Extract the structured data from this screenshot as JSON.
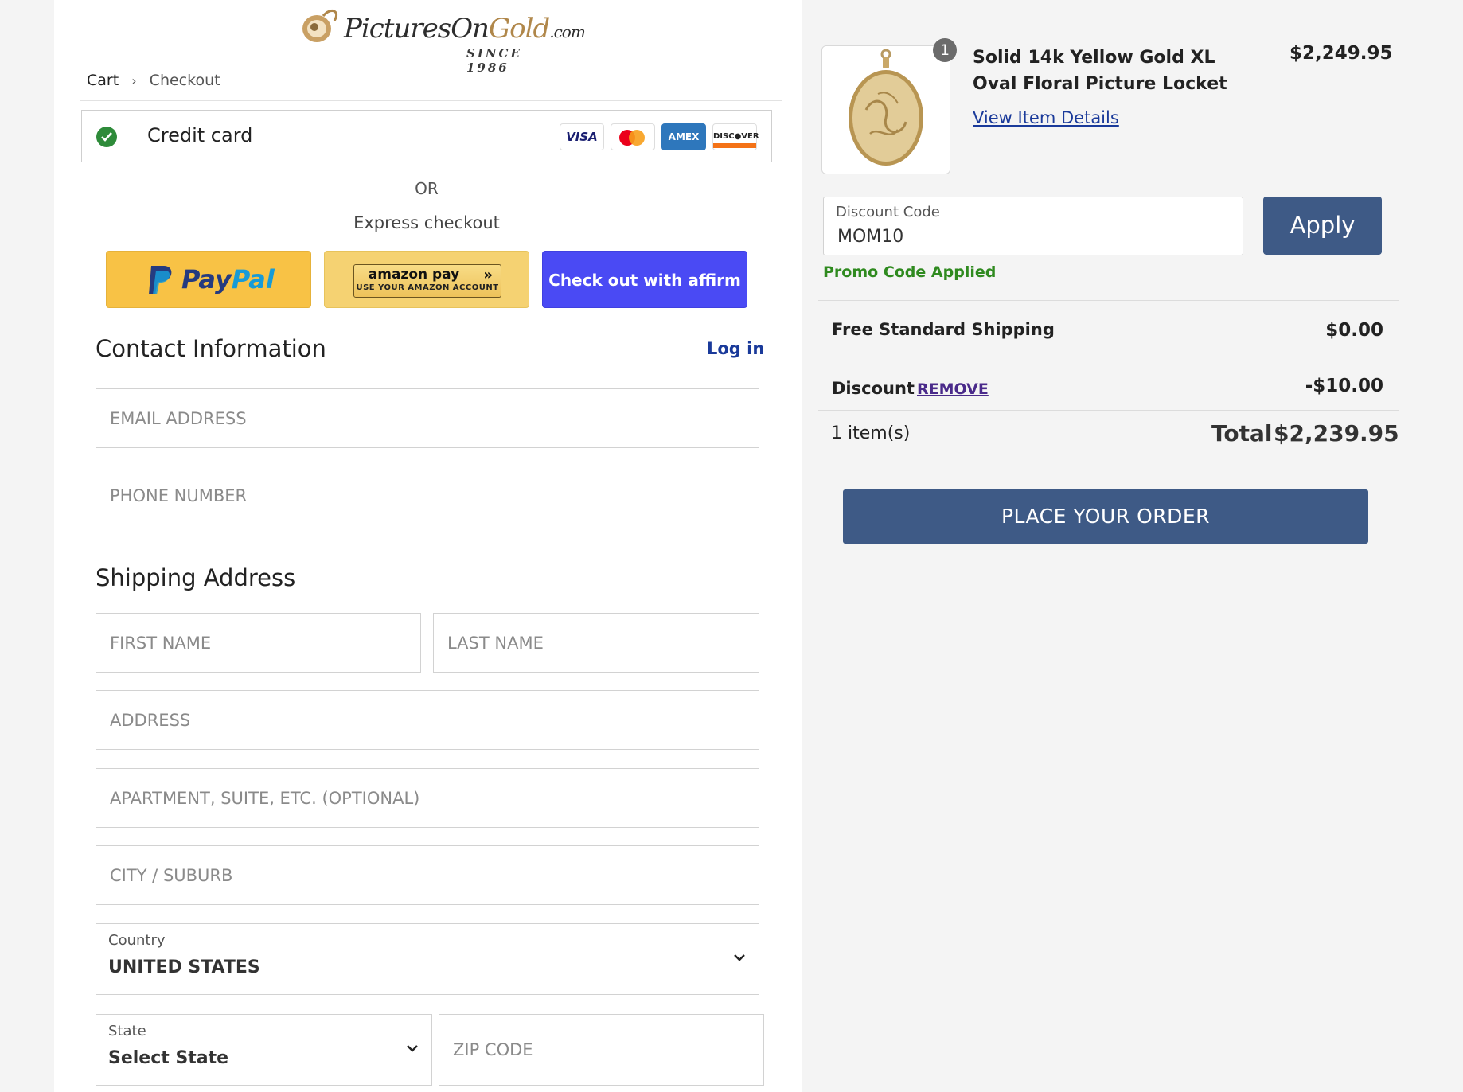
{
  "brand": {
    "logo_prefix": "Pictures",
    "logo_mid": "On",
    "logo_gold": "Gold",
    "logo_suffix": ".com",
    "since": "SINCE 1986"
  },
  "breadcrumb": {
    "cart": "Cart",
    "separator": "›",
    "checkout": "Checkout"
  },
  "payment": {
    "credit_card_label": "Credit card",
    "cards": {
      "visa": "VISA",
      "amex": "AMEX",
      "discover": "DISC●VER"
    },
    "or_label": "OR",
    "express_label": "Express checkout",
    "paypal_pay": "Pay",
    "paypal_pal": "Pal",
    "amazon_top": "amazon pay",
    "amazon_arrows": "»",
    "amazon_bottom": "USE YOUR AMAZON ACCOUNT",
    "affirm_label": "Check out with affirm"
  },
  "contact": {
    "title": "Contact Information",
    "login": "Log in",
    "email_placeholder": "EMAIL ADDRESS",
    "phone_placeholder": "PHONE NUMBER"
  },
  "shipping": {
    "title": "Shipping Address",
    "first_name_placeholder": "FIRST NAME",
    "last_name_placeholder": "LAST NAME",
    "address_placeholder": "ADDRESS",
    "apartment_placeholder": "APARTMENT, SUITE, ETC. (OPTIONAL)",
    "city_placeholder": "CITY / SUBURB",
    "country_label": "Country",
    "country_value": "UNITED STATES",
    "state_label": "State",
    "state_value": "Select State",
    "zip_placeholder": "ZIP CODE"
  },
  "order": {
    "quantity_badge": "1",
    "product_name": "Solid 14k Yellow Gold XL Oval Floral Picture Locket",
    "product_price": "$2,249.95",
    "view_details": "View Item Details",
    "discount_label": "Discount Code",
    "discount_value": "MOM10",
    "apply_label": "Apply",
    "promo_status": "Promo Code Applied",
    "shipping_label": "Free Standard Shipping",
    "shipping_value": "$0.00",
    "discount_row_label": "Discount",
    "remove_label": "REMOVE",
    "discount_row_value": "-$10.00",
    "items_count": "1 item(s)",
    "total_label": "Total",
    "total_value": "$2,239.95",
    "place_order": "PLACE YOUR ORDER"
  },
  "colors": {
    "primary_button": "#3e5a86",
    "promo_green": "#2f8a1f",
    "affirm_blue": "#4a4af4",
    "paypal_yellow": "#f8c245",
    "link_blue": "#1a3a9a"
  }
}
